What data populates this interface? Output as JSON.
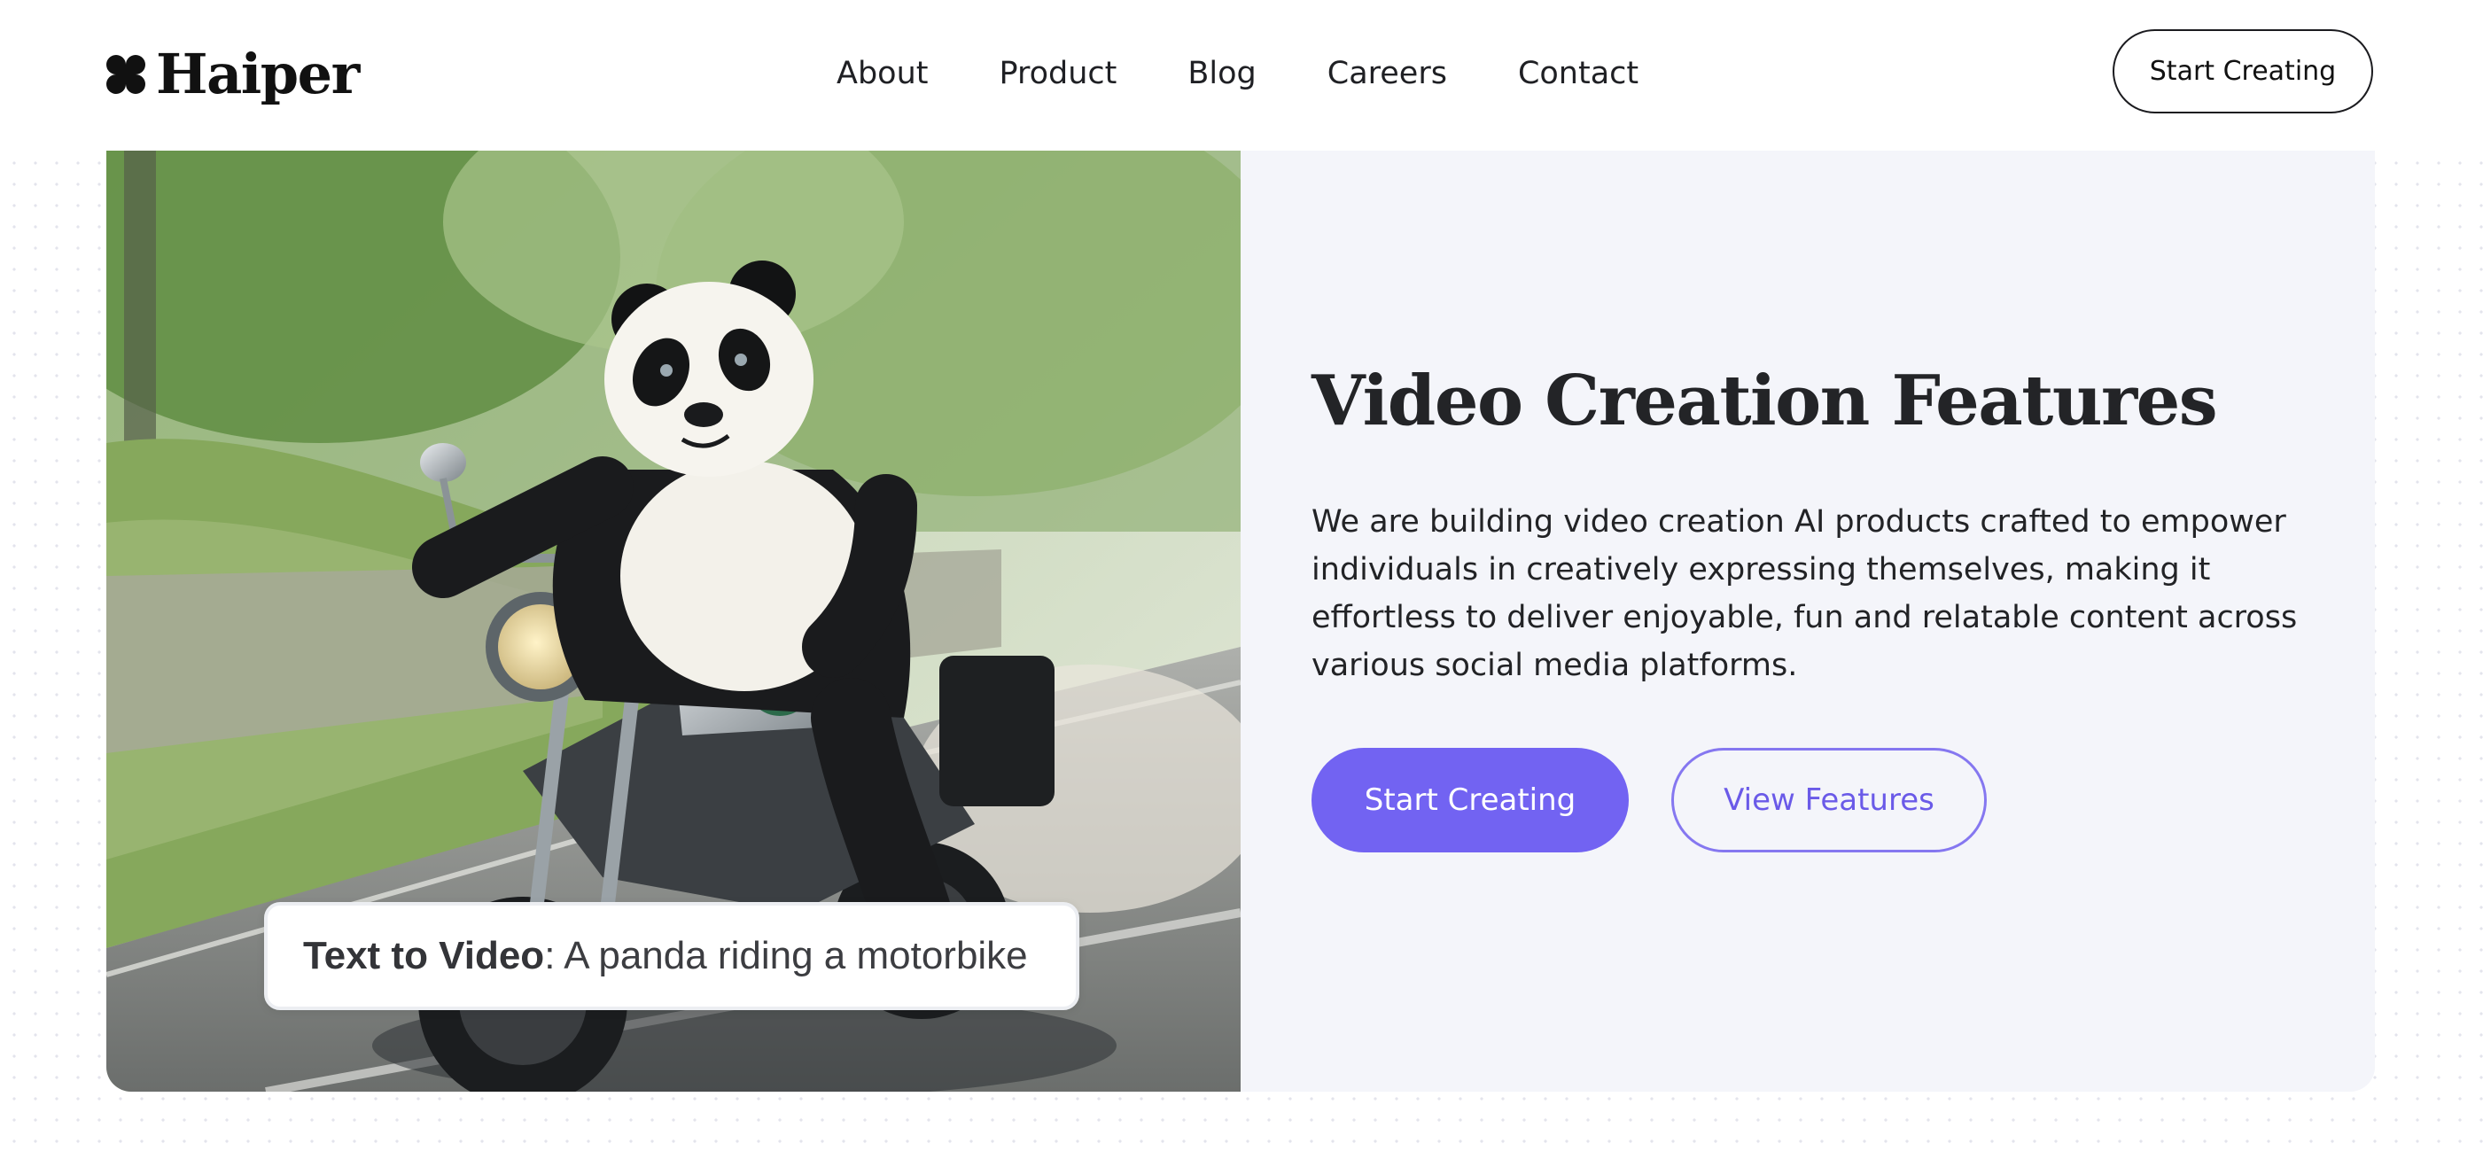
{
  "brand": {
    "name": "Haiper",
    "logo_icon": "clover-logo-icon"
  },
  "nav": {
    "items": [
      {
        "label": "About"
      },
      {
        "label": "Product"
      },
      {
        "label": "Blog"
      },
      {
        "label": "Careers"
      },
      {
        "label": "Contact"
      }
    ]
  },
  "header": {
    "cta_label": "Start Creating"
  },
  "hero": {
    "caption": {
      "strong": "Text to Video",
      "rest": ": A panda riding a motorbike"
    },
    "title": "Video Creation Features",
    "description": "We are building video creation AI products crafted to empower individuals in creatively expressing themselves, making it effortless to deliver enjoyable, fun and relatable content across various social media platforms.",
    "primary_cta": "Start Creating",
    "secondary_cta": "View Features"
  },
  "colors": {
    "accent": "#7263f2",
    "accent_outline": "#8577f0",
    "card_background": "#f4f5fa",
    "text": "#222326"
  }
}
